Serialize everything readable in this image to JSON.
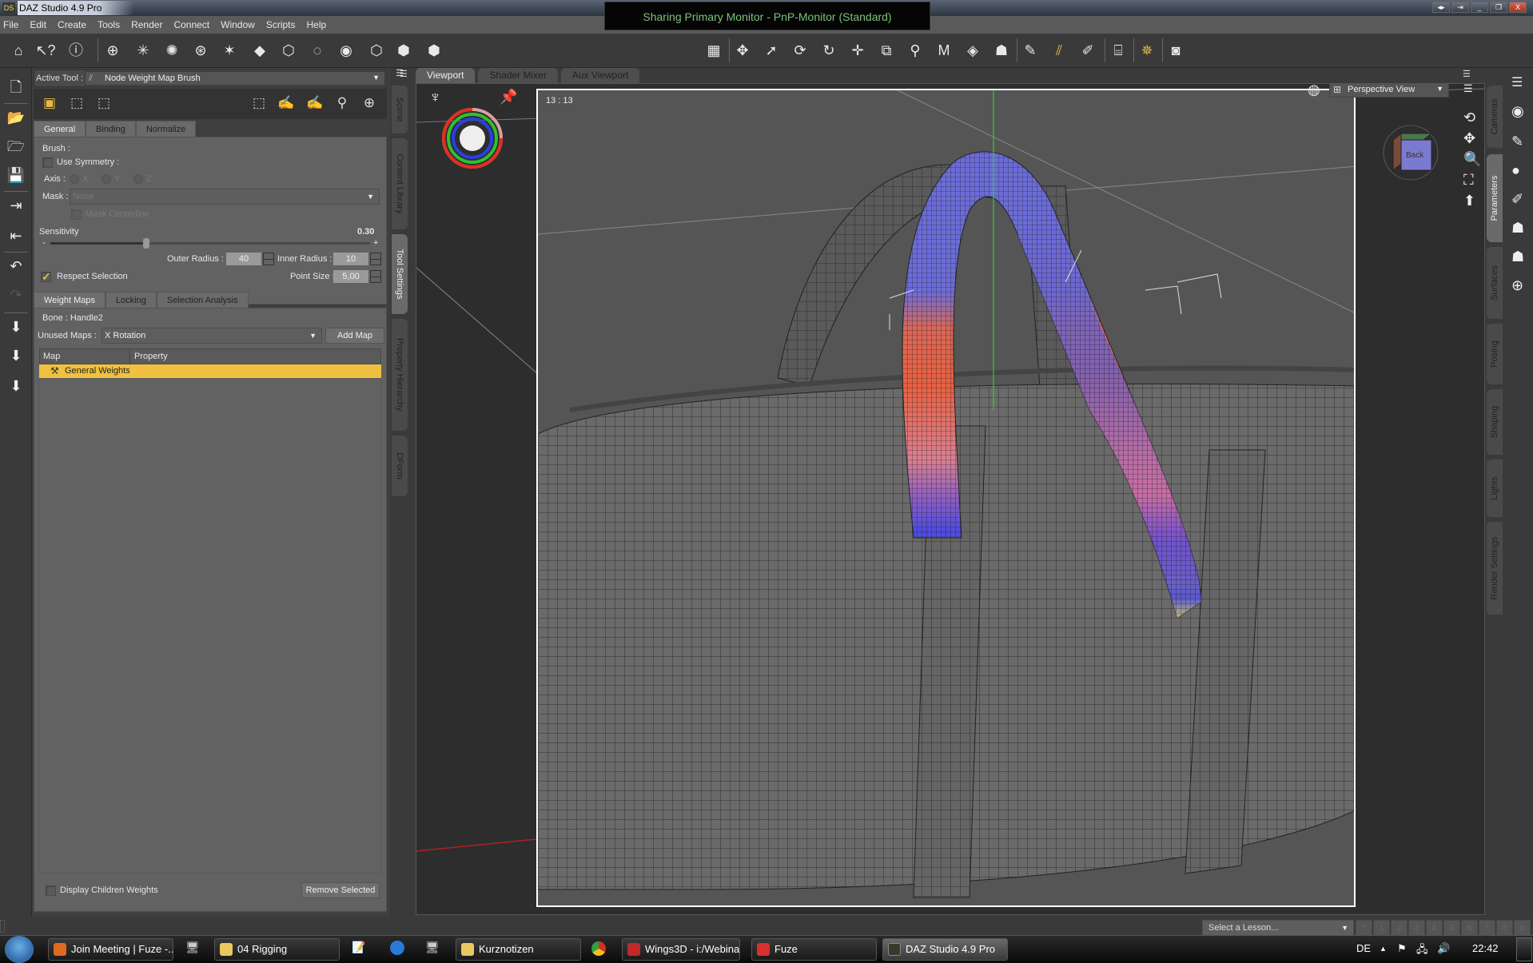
{
  "window": {
    "app_logo": "DS",
    "title": "DAZ Studio 4.9 Pro",
    "sharing_banner": "Sharing Primary Monitor - PnP-Monitor (Standard)",
    "controls": [
      "◂▸",
      "⇥",
      "_",
      "❐",
      "X"
    ]
  },
  "menu": [
    "File",
    "Edit",
    "Create",
    "Tools",
    "Render",
    "Connect",
    "Window",
    "Scripts",
    "Help"
  ],
  "toolbar": {
    "left_icons": [
      "home-icon",
      "whats-this-icon",
      "help-icon",
      "new-camera-icon",
      "new-distant-light-icon",
      "new-point-light-icon",
      "new-spotlight-icon",
      "new-linear-light-icon",
      "new-primitive-icon",
      "new-node-icon",
      "new-null-icon",
      "new-group-icon",
      "new-instance-icon",
      "new-multi-instance-icon",
      "new-proxy-icon"
    ],
    "center_icons": [
      "scene-grid-icon",
      "universal-tool-icon",
      "node-selection-icon",
      "rotate-tool-icon",
      "twist-tool-icon",
      "translate-tool-icon",
      "scale-tool-icon",
      "joint-editor-icon",
      "geometry-editor-icon",
      "surface-selection-icon",
      "figure-region-icon",
      "transfer-utility-icon",
      "weight-brush-icon",
      "node-weight-map-icon",
      "spot-render-icon",
      "active-pose-icon",
      "render-icon"
    ]
  },
  "left_bar": [
    "new-scene-icon",
    "open-icon",
    "merge-icon",
    "save-icon",
    "import-icon",
    "export-icon",
    "undo-icon",
    "redo-icon",
    "load-figure-icon",
    "load-prop-icon",
    "load-pose-icon"
  ],
  "tool_settings": {
    "active_tool_label": "Active Tool :",
    "active_tool_value": "Node Weight Map Brush",
    "tabs": [
      "General",
      "Binding",
      "Normalize"
    ],
    "brush_label": "Brush :",
    "use_symmetry": "Use Symmetry :",
    "use_symmetry_checked": false,
    "axis_label": "Axis :",
    "axis_options": [
      "X",
      "Y",
      "Z"
    ],
    "mask_label": "Mask :",
    "mask_value": "None",
    "mask_centerline": "Mask Centerline",
    "sensitivity_label": "Sensitivity",
    "sensitivity_value": "0.30",
    "sensitivity_fraction": 0.3,
    "slider_minus": "-",
    "slider_plus": "+",
    "outer_radius_label": "Outer Radius :",
    "outer_radius_value": "40",
    "inner_radius_label": "Inner Radius :",
    "inner_radius_value": "10",
    "point_size_label": "Point Size :",
    "point_size_value": "5,00",
    "respect_selection": "Respect Selection",
    "respect_selection_checked": true
  },
  "weight_maps": {
    "tabs": [
      "Weight Maps",
      "Locking",
      "Selection Analysis"
    ],
    "bone_label": "Bone : Handle2",
    "unused_maps_label": "Unused Maps :",
    "unused_maps_value": "X Rotation",
    "add_map": "Add Map",
    "columns": [
      "Map",
      "Property"
    ],
    "rows": [
      {
        "map": "General Weights",
        "property": "",
        "selected": true
      }
    ],
    "display_children_weights": "Display Children Weights",
    "remove_selected": "Remove Selected"
  },
  "left_vertical_tabs": [
    "Scene",
    "Content Library",
    "Tool Settings",
    "Property Hierarchy",
    "DForm"
  ],
  "left_vertical_active": "Tool Settings",
  "viewport": {
    "tabs": [
      "Viewport",
      "Shader Mixer",
      "Aux Viewport"
    ],
    "active_tab": "Viewport",
    "aspect_label": "13 : 13",
    "view_select": "Perspective View",
    "cube_face": "Back",
    "cube_axis": "Z",
    "controls": [
      "orbit-icon",
      "pan-icon",
      "zoom-icon",
      "frame-icon",
      "reset-icon"
    ]
  },
  "right_vertical_tabs": [
    "Cameras",
    "Parameters",
    "Surfaces",
    "Posing",
    "Shaping",
    "Lights",
    "Render Settings"
  ],
  "right_icons": [
    "pane-options-icon",
    "smart-content-icon",
    "joint-edit-icon",
    "node-weight-icon",
    "rigging-icon",
    "pose-icon",
    "pose-p-icon",
    "environment-icon"
  ],
  "lesson_bar": {
    "placeholder": "Select a Lesson...",
    "steps": [
      "?",
      "1",
      "2",
      "3",
      "4",
      "5",
      "6",
      "7",
      "8",
      "9"
    ]
  },
  "taskbar": {
    "items": [
      {
        "label": "Join Meeting | Fuze -...",
        "color": "#e06a20"
      },
      {
        "label": "04 Rigging",
        "color": "#e8c860"
      },
      {
        "label": "Kurznotizen",
        "color": "#e8c860"
      },
      {
        "label": "Wings3D - i:/Webina...",
        "color": "#c02a2a"
      },
      {
        "label": "Fuze",
        "color": "#d83030"
      },
      {
        "label": "DAZ Studio 4.9 Pro",
        "color": "#3a3a2a"
      }
    ],
    "language": "DE",
    "clock": "22:42"
  },
  "colors": {
    "accent": "#e8b84a",
    "selection_row": "#f0c040",
    "banner_text": "#7cc27c",
    "weight_high": "#e86040",
    "weight_low": "#5050e0",
    "weight_yellow": "#e8e040"
  }
}
